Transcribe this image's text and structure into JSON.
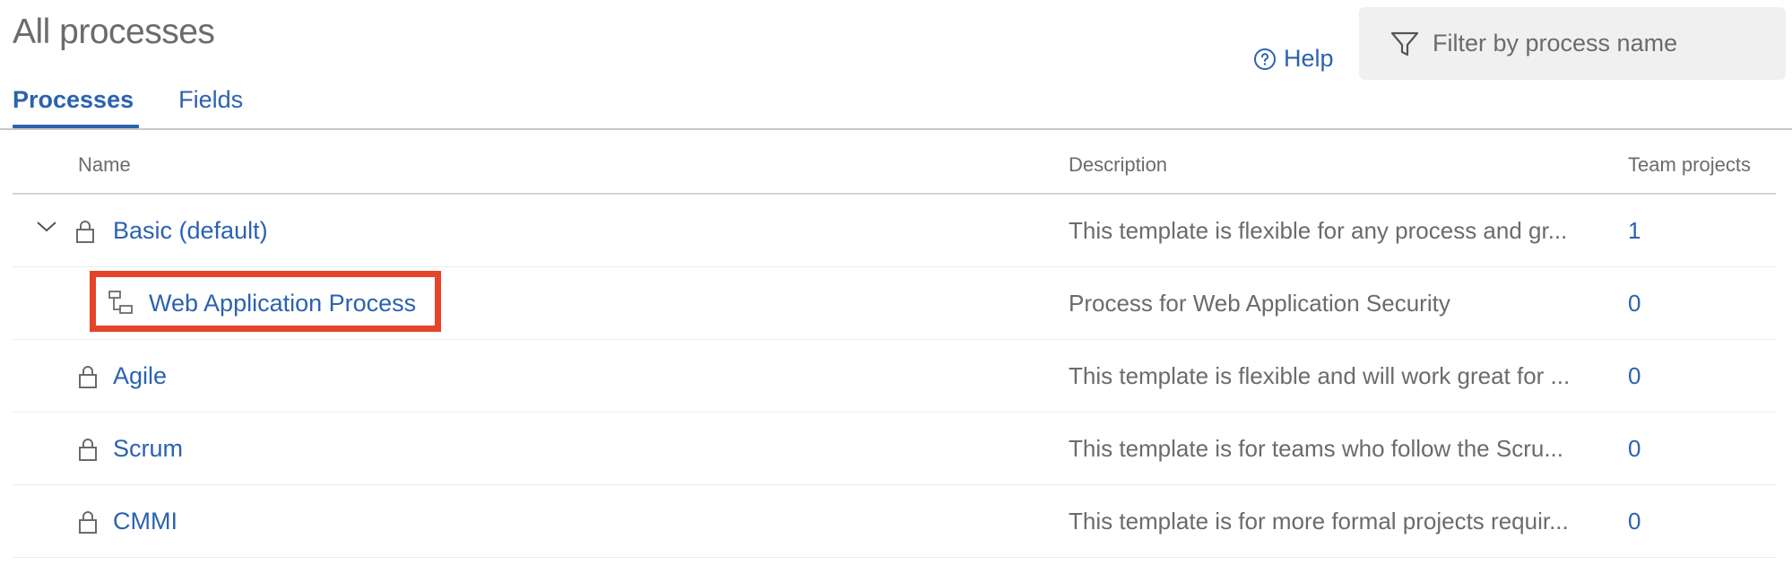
{
  "page": {
    "title": "All processes"
  },
  "help": {
    "label": "Help",
    "icon": "help-circle-icon"
  },
  "filter": {
    "placeholder": "Filter by process name",
    "icon": "filter-icon"
  },
  "tabs": [
    {
      "label": "Processes",
      "active": true
    },
    {
      "label": "Fields",
      "active": false
    }
  ],
  "table": {
    "headers": {
      "name": "Name",
      "description": "Description",
      "team_projects": "Team projects"
    },
    "rows": [
      {
        "name": "Basic (default)",
        "description": "This template is flexible for any process and gr...",
        "count": "1",
        "icon": "lock-icon",
        "expanded": true
      },
      {
        "name": "Web Application Process",
        "description": "Process for Web Application Security",
        "count": "0",
        "icon": "inherited-process-icon"
      },
      {
        "name": "Agile",
        "description": "This template is flexible and will work great for ...",
        "count": "0",
        "icon": "lock-icon"
      },
      {
        "name": "Scrum",
        "description": "This template is for teams who follow the Scru...",
        "count": "0",
        "icon": "lock-icon"
      },
      {
        "name": "CMMI",
        "description": "This template is for more formal projects requir...",
        "count": "0",
        "icon": "lock-icon"
      }
    ]
  },
  "colors": {
    "link": "#2b62b0",
    "highlight": "#e5432a",
    "muted": "#6b6b6b"
  }
}
